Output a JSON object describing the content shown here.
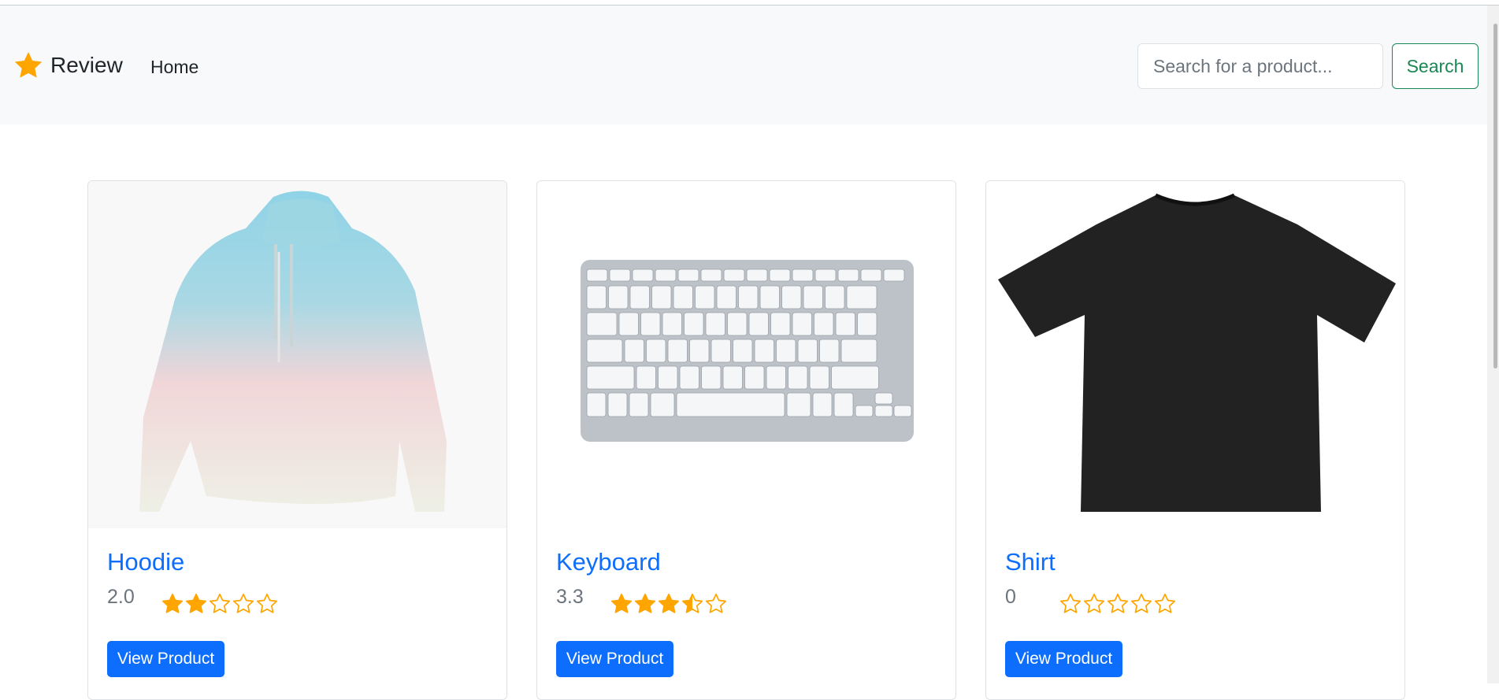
{
  "navbar": {
    "brand": "Review",
    "home_link": "Home",
    "search_placeholder": "Search for a product...",
    "search_button": "Search"
  },
  "colors": {
    "accent": "#0d6efd",
    "star": "#ffa500",
    "search_button": "#198754"
  },
  "products": [
    {
      "name": "Hoodie",
      "rating_text": "2.0",
      "rating": 2.0,
      "max": 5,
      "button": "View Product",
      "image": "hoodie-image"
    },
    {
      "name": "Keyboard",
      "rating_text": "3.3",
      "rating": 3.3,
      "max": 5,
      "button": "View Product",
      "image": "keyboard-image"
    },
    {
      "name": "Shirt",
      "rating_text": "0",
      "rating": 0,
      "max": 5,
      "button": "View Product",
      "image": "shirt-image"
    }
  ]
}
